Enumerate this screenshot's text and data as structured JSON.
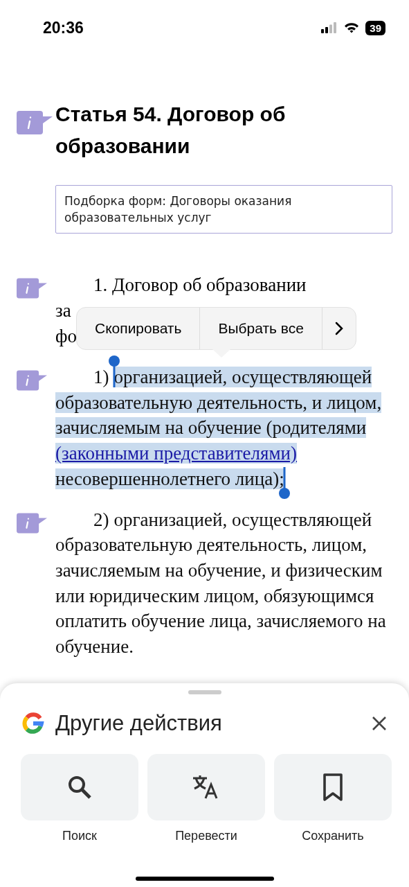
{
  "status_bar": {
    "time": "20:36",
    "battery": "39"
  },
  "article": {
    "heading": "Статья 54. Договор об образовании",
    "note": "Подборка форм: Договоры оказания образовательных услуг",
    "paragraphs": [
      {
        "kind": "covered",
        "selected": false,
        "lines": [
          "1. Договор об образовании",
          "за",
          "фо"
        ]
      },
      {
        "kind": "text",
        "selected": true,
        "number": "1)",
        "parts": [
          {
            "text": "организацией, осуществляющей образовательную деятельность, и лицом, зачисляемым на обучение (родителями ",
            "link": false
          },
          {
            "text": "(законными представителями)",
            "link": true
          },
          {
            "text": " несовершеннолетнего лица);",
            "link": false
          }
        ]
      },
      {
        "kind": "text",
        "selected": false,
        "number": "2)",
        "parts": [
          {
            "text": "организацией, осуществляющей образовательную деятельность, лицом, зачисляемым на обучение, и физическим или юридическим лицом, обязующимся оплатить обучение лица, зачисляемого на обучение.",
            "link": false
          }
        ]
      }
    ]
  },
  "context_menu": {
    "items": [
      "Скопировать",
      "Выбрать все"
    ]
  },
  "sheet": {
    "title": "Другие действия",
    "actions": [
      {
        "kind": "search",
        "label": "Поиск"
      },
      {
        "kind": "translate",
        "label": "Перевести"
      },
      {
        "kind": "bookmark",
        "label": "Сохранить"
      }
    ]
  }
}
